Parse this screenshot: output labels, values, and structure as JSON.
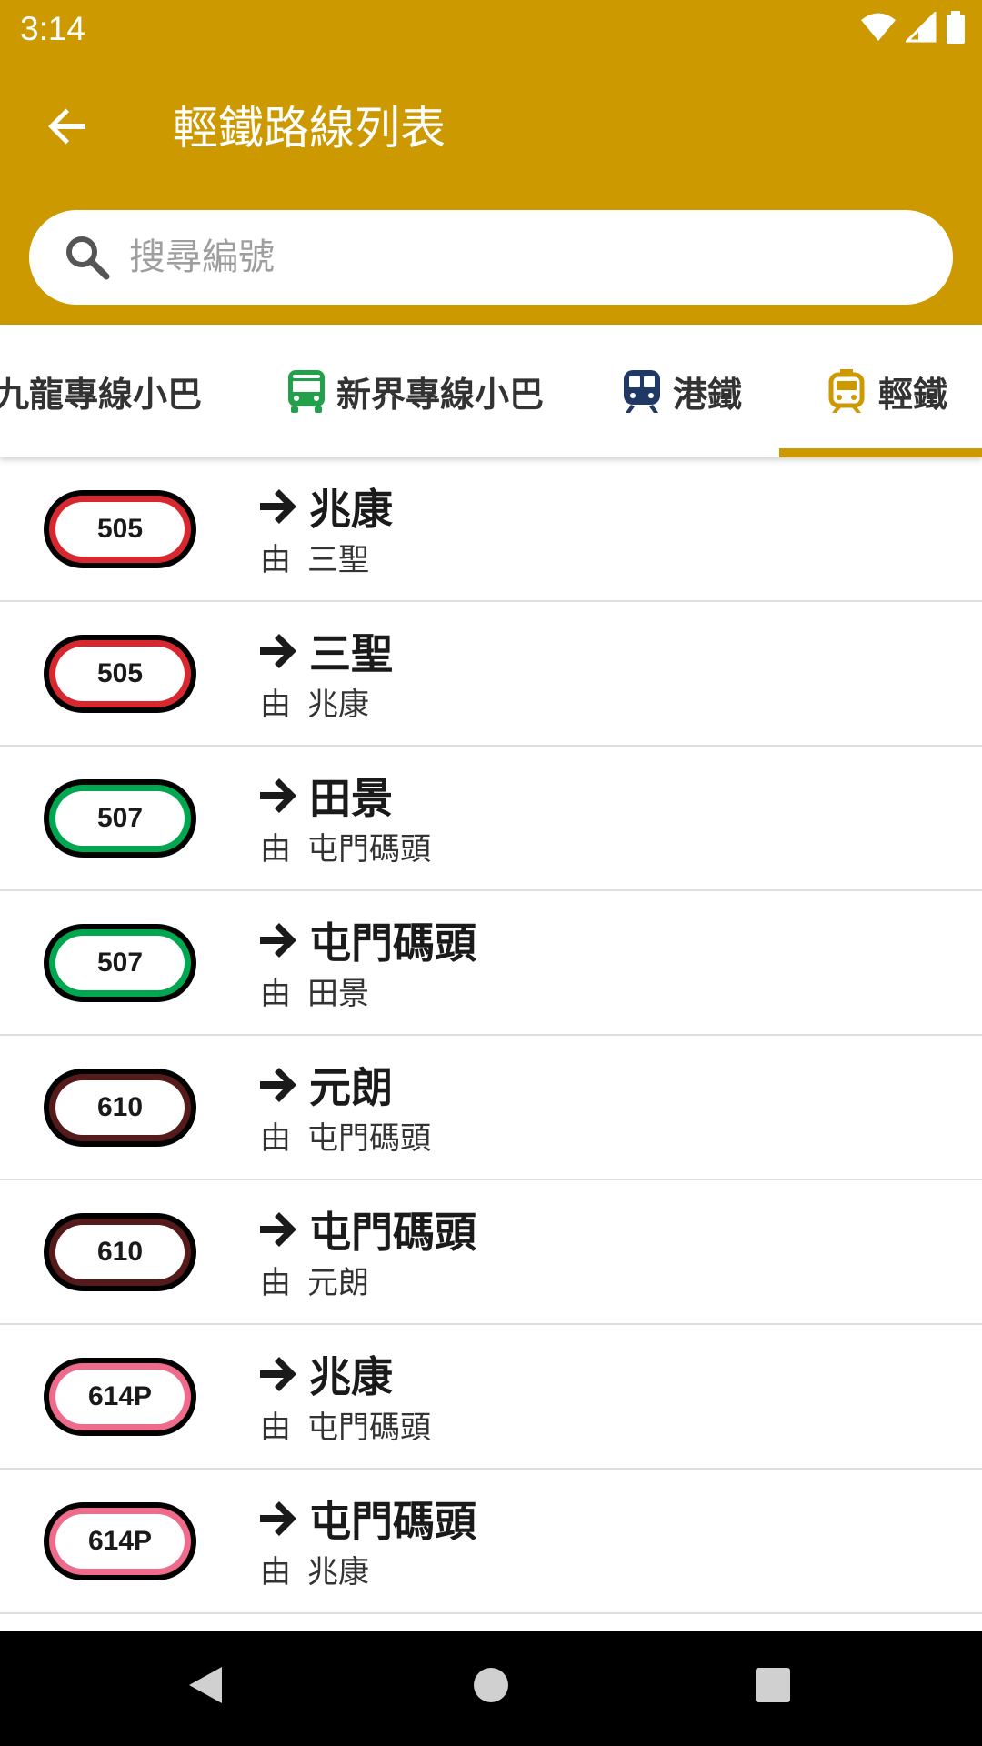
{
  "status_bar": {
    "time": "3:14",
    "icons": [
      "wifi-icon",
      "cell-signal-icon",
      "battery-icon"
    ]
  },
  "app_bar": {
    "title": "輕鐵路線列表",
    "back_icon": "arrow-back-icon",
    "background_color": "#cc9900"
  },
  "search": {
    "placeholder": "搜尋編號",
    "value": "",
    "icon": "search-icon"
  },
  "tabs": [
    {
      "label": "九龍專線小巴",
      "icon": "",
      "selected": false
    },
    {
      "label": "新界專線小巴",
      "icon": "minibus-icon",
      "icon_color": "#22a04b",
      "selected": false
    },
    {
      "label": "港鐵",
      "icon": "train-icon",
      "icon_color": "#1f3864",
      "selected": false
    },
    {
      "label": "輕鐵",
      "icon": "tram-icon",
      "icon_color": "#cc9900",
      "selected": true
    }
  ],
  "routes": [
    {
      "number": "505",
      "destination": "兆康",
      "origin_prefix": "由",
      "origin": "三聖",
      "color": "#d7282f"
    },
    {
      "number": "505",
      "destination": "三聖",
      "origin_prefix": "由",
      "origin": "兆康",
      "color": "#d7282f"
    },
    {
      "number": "507",
      "destination": "田景",
      "origin_prefix": "由",
      "origin": "屯門碼頭",
      "color": "#00a650"
    },
    {
      "number": "507",
      "destination": "屯門碼頭",
      "origin_prefix": "由",
      "origin": "田景",
      "color": "#00a650"
    },
    {
      "number": "610",
      "destination": "元朗",
      "origin_prefix": "由",
      "origin": "屯門碼頭",
      "color": "#551a1a"
    },
    {
      "number": "610",
      "destination": "屯門碼頭",
      "origin_prefix": "由",
      "origin": "元朗",
      "color": "#551a1a"
    },
    {
      "number": "614P",
      "destination": "兆康",
      "origin_prefix": "由",
      "origin": "屯門碼頭",
      "color": "#ee6b8b"
    },
    {
      "number": "614P",
      "destination": "屯門碼頭",
      "origin_prefix": "由",
      "origin": "兆康",
      "color": "#ee6b8b"
    }
  ],
  "nav_bar": {
    "icons": [
      "nav-back-icon",
      "nav-home-icon",
      "nav-recents-icon"
    ]
  }
}
